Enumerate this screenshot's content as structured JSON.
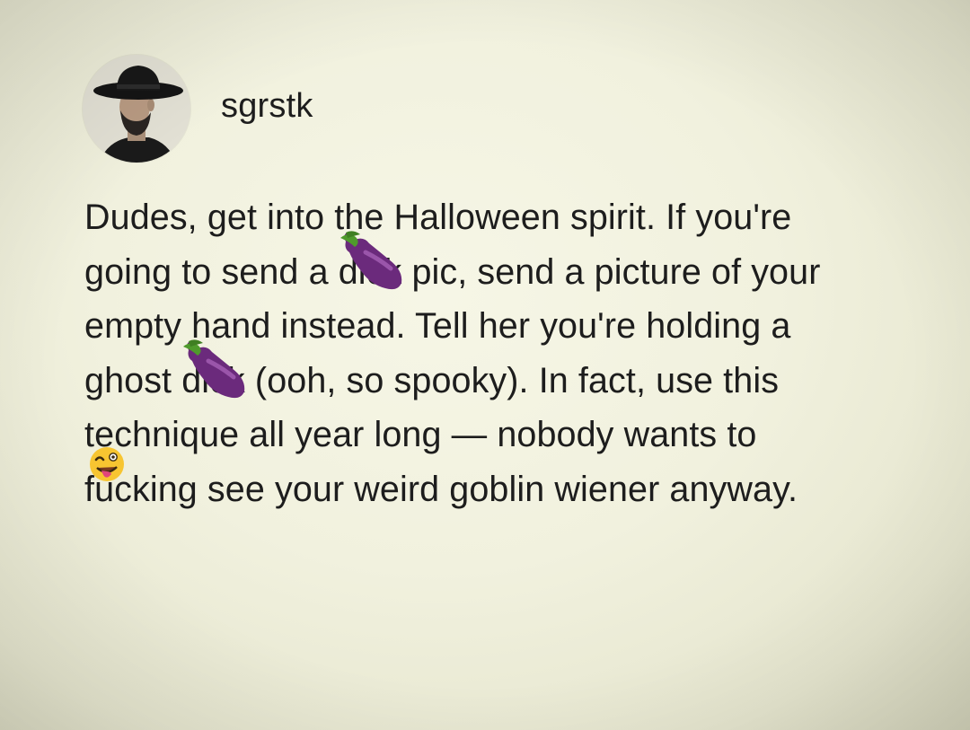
{
  "post": {
    "username": "sgrstk",
    "avatar_icon": "avatar-man-with-wide-brim-hat",
    "lines": [
      {
        "text": "Dudes, get into the Halloween spirit. If you're"
      },
      {
        "before": "going to send a ",
        "censored": "dick",
        "censor_emoji": "eggplant-emoji",
        "after": " pic, send a picture of your"
      },
      {
        "text": "empty hand instead. Tell her you're holding a"
      },
      {
        "before": "ghost ",
        "censored": "dick",
        "censor_emoji": "eggplant-emoji",
        "after": " (ooh, so spooky). In fact, use this"
      },
      {
        "text": "technique all year long — nobody wants to"
      },
      {
        "before": "f",
        "censored": "uc",
        "censor_emoji": "zany-face-emoji",
        "after": "king see your weird goblin wiener anyway."
      }
    ]
  },
  "colors": {
    "background": "#f1f1de",
    "text": "#1d1d1d",
    "eggplant": "#6a2a7a",
    "eggplant_leaf": "#4a8a2a",
    "zany_face": "#f7c531",
    "tongue": "#e0457b"
  }
}
